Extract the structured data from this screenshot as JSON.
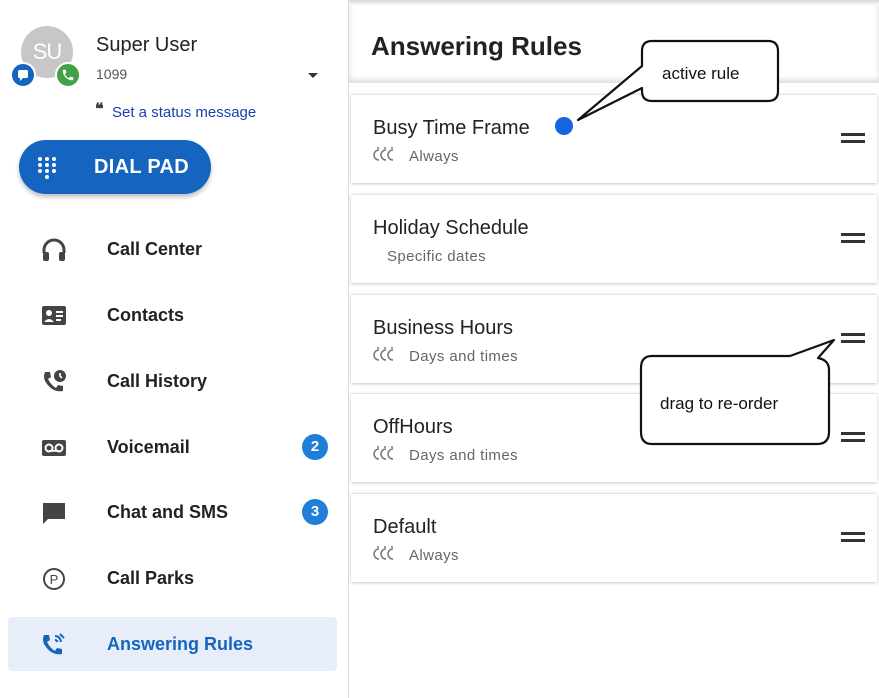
{
  "user": {
    "initials": "SU",
    "name": "Super User",
    "extension": "1099",
    "status_quote": "❝",
    "status_link": "Set a status message"
  },
  "dialpad": {
    "label": "DIAL PAD"
  },
  "nav": {
    "items": [
      {
        "label": "Call Center",
        "icon": "headset-icon"
      },
      {
        "label": "Contacts",
        "icon": "contact-card-icon"
      },
      {
        "label": "Call History",
        "icon": "phone-history-icon"
      },
      {
        "label": "Voicemail",
        "icon": "voicemail-icon",
        "count": "2"
      },
      {
        "label": "Chat and SMS",
        "icon": "chat-icon",
        "count": "3"
      },
      {
        "label": "Call Parks",
        "icon": "parking-icon"
      },
      {
        "label": "Answering Rules",
        "icon": "phone-forward-icon",
        "active": true
      }
    ]
  },
  "main": {
    "title": "Answering Rules",
    "rules": [
      {
        "name": "Busy Time Frame",
        "schedule": "Always",
        "active": true
      },
      {
        "name": "Holiday Schedule",
        "schedule": "Specific dates"
      },
      {
        "name": "Business Hours",
        "schedule": "Days and times"
      },
      {
        "name": "OffHours",
        "schedule": "Days and times"
      },
      {
        "name": "Default",
        "schedule": "Always"
      }
    ]
  },
  "callouts": {
    "active_rule": "active rule",
    "drag": "drag to re-order"
  },
  "colors": {
    "accent": "#1565c0",
    "active_dot": "#1565e0",
    "badge": "#1f7fd8",
    "active_nav_bg": "#e7eef9"
  }
}
